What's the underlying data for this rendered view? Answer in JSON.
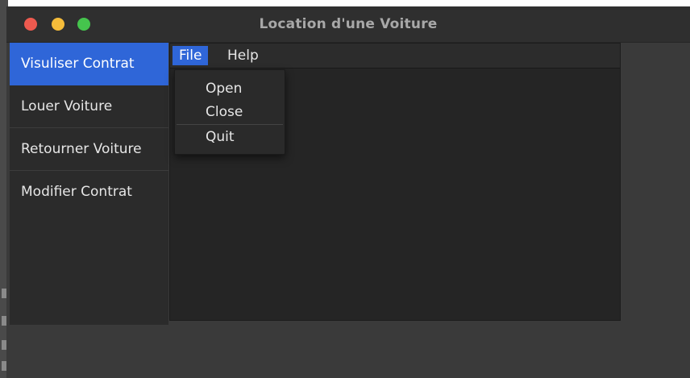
{
  "window": {
    "title": "Location d'une Voiture"
  },
  "sidebar": {
    "items": [
      {
        "label": "Visuliser Contrat",
        "selected": true
      },
      {
        "label": "Louer Voiture",
        "selected": false
      },
      {
        "label": "Retourner Voiture",
        "selected": false
      },
      {
        "label": "Modifier Contrat",
        "selected": false
      }
    ]
  },
  "menubar": {
    "menus": [
      {
        "label": "File",
        "active": true
      },
      {
        "label": "Help",
        "active": false
      }
    ]
  },
  "file_menu": {
    "items": [
      {
        "label": "Open"
      },
      {
        "label": "Close"
      },
      {
        "label": "Quit"
      }
    ]
  },
  "colors": {
    "accent": "#2f66d8",
    "titlebar": "#2f2f2f",
    "window_bg": "#3a3a3a",
    "sidebar_bg": "#2b2b2b",
    "content_bg": "#252525",
    "close_button": "#ee5a4f",
    "minimize_button": "#f5bc3a",
    "maximize_button": "#45c44d"
  }
}
